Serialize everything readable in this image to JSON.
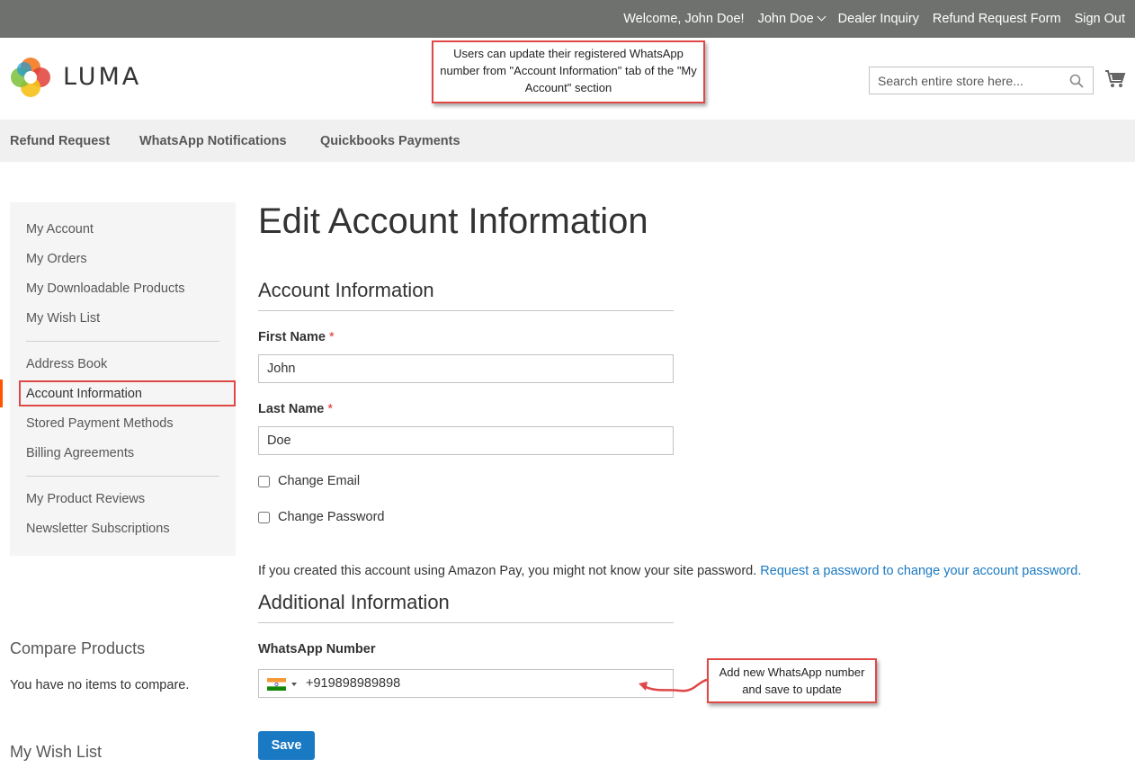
{
  "header_links": {
    "welcome": "Welcome, John Doe!",
    "account_name": "John Doe",
    "dealer_inquiry": "Dealer Inquiry",
    "refund_form": "Refund Request Form",
    "sign_out": "Sign Out"
  },
  "logo": {
    "text": "LUMA"
  },
  "search": {
    "placeholder": "Search entire store here..."
  },
  "annotations": {
    "top": "Users can update their registered WhatsApp number from \"Account Information\" tab of the \"My Account\" section",
    "bottom": "Add new WhatsApp number and save to update"
  },
  "nav": {
    "items": [
      "Refund Request",
      "WhatsApp Notifications",
      "Quickbooks Payments"
    ]
  },
  "sidebar": {
    "items": [
      "My Account",
      "My Orders",
      "My Downloadable Products",
      "My Wish List",
      "Address Book",
      "Account Information",
      "Stored Payment Methods",
      "Billing Agreements",
      "My Product Reviews",
      "Newsletter Subscriptions"
    ],
    "active": "Account Information"
  },
  "compare": {
    "title": "Compare Products",
    "empty": "You have no items to compare."
  },
  "wishlist_block": {
    "title": "My Wish List"
  },
  "main": {
    "page_title": "Edit Account Information",
    "account_section": "Account Information",
    "first_name_label": "First Name",
    "first_name_value": "John",
    "last_name_label": "Last Name",
    "last_name_value": "Doe",
    "required_mark": "*",
    "change_email": "Change Email",
    "change_password": "Change Password",
    "amazon_note": "If you created this account using Amazon Pay, you might not know your site password.",
    "amazon_link": "Request a password to change your account password.",
    "additional_section": "Additional Information",
    "whatsapp_label": "WhatsApp Number",
    "whatsapp_value": "+919898989898",
    "save_label": "Save"
  },
  "colors": {
    "topbar": "#6e716e",
    "accent_blue": "#1979c3",
    "annotation_red": "#e04848",
    "active_bar": "#ff5501"
  },
  "icons": {
    "search": "search-icon",
    "cart": "cart-icon",
    "flag": "india-flag-icon",
    "dropdown": "chevron-down-icon"
  }
}
